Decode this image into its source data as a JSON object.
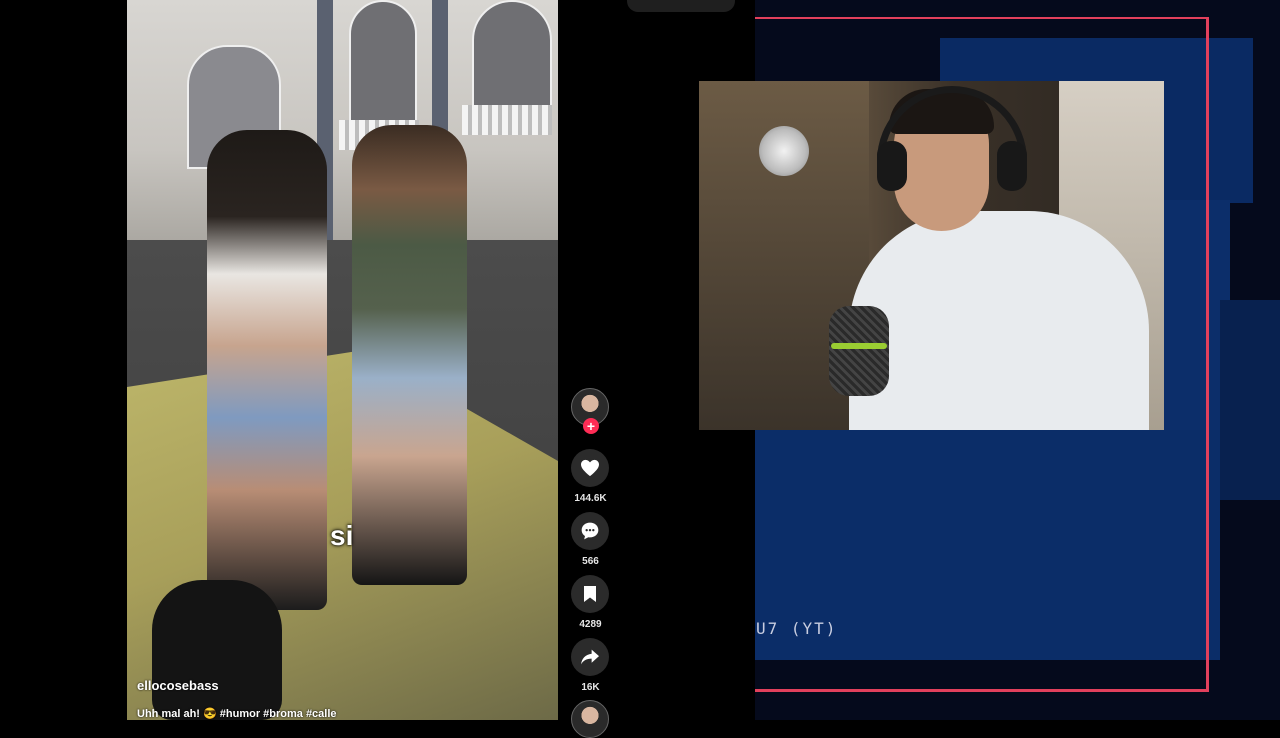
{
  "video": {
    "author": "ellocosebass",
    "description": "Uhh mal ah! 😎 #humor #broma #calle",
    "caption_word": "si"
  },
  "actions": {
    "like_count": "144.6K",
    "comment_count": "566",
    "save_count": "4289",
    "share_count": "16K",
    "follow_symbol": "+"
  },
  "stream": {
    "credit_text": "U7 (YT)"
  },
  "colors": {
    "accent_red": "#e2405c",
    "panel_blue": "#0a2a63",
    "follow_pink": "#fe2c55"
  }
}
